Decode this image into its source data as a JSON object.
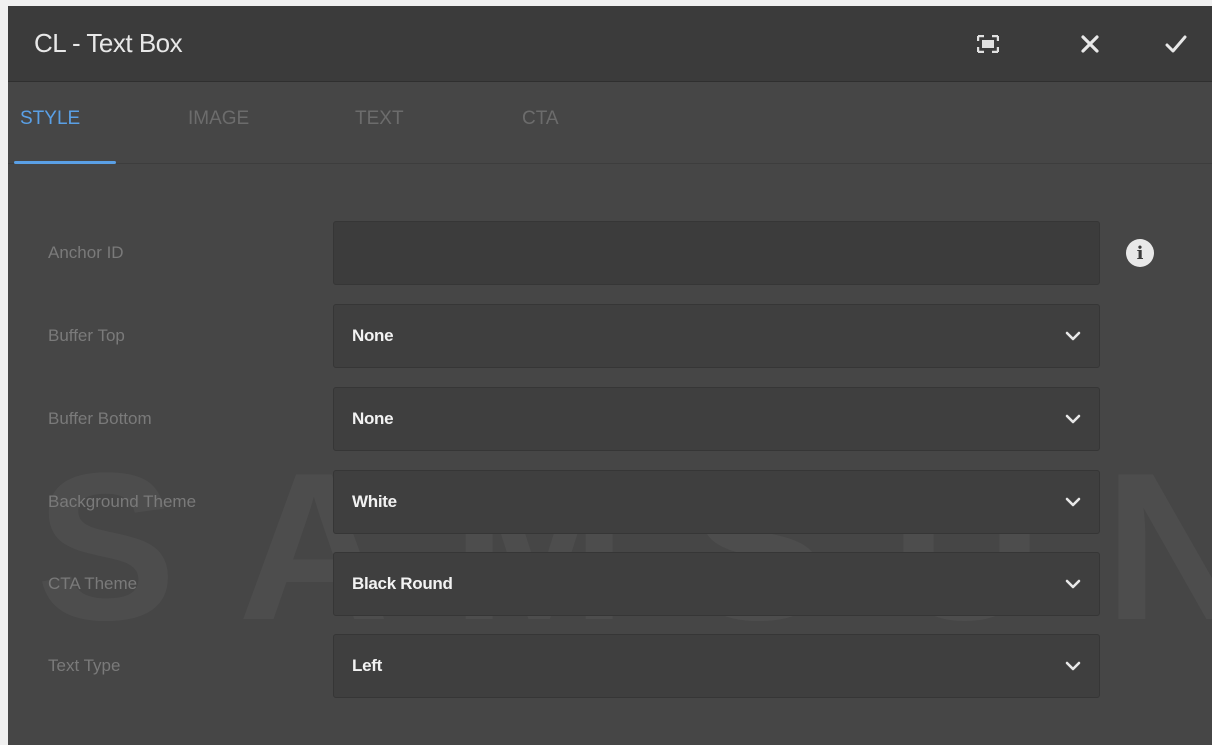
{
  "dialog": {
    "title": "CL - Text Box",
    "actions": {
      "fullscreen_icon": "fullscreen-icon",
      "close_icon": "close-icon",
      "confirm_icon": "checkmark-icon"
    }
  },
  "tabs": [
    {
      "label": "STYLE",
      "active": true
    },
    {
      "label": "IMAGE",
      "active": false
    },
    {
      "label": "TEXT",
      "active": false
    },
    {
      "label": "CTA",
      "active": false
    }
  ],
  "watermark": "SAMSUNG",
  "form": {
    "anchor_id": {
      "label": "Anchor ID",
      "value": ""
    },
    "buffer_top": {
      "label": "Buffer Top",
      "value": "None"
    },
    "buffer_bottom": {
      "label": "Buffer Bottom",
      "value": "None"
    },
    "background_theme": {
      "label": "Background Theme",
      "value": "White"
    },
    "cta_theme": {
      "label": "CTA Theme",
      "value": "Black Round"
    },
    "text_type": {
      "label": "Text Type",
      "value": "Left"
    }
  },
  "colors": {
    "accent": "#5aa0e6",
    "panel": "#464646",
    "header": "#3b3b3b"
  }
}
